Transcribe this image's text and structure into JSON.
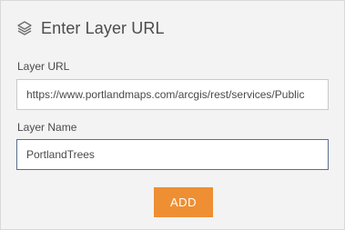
{
  "header": {
    "icon": "layers-icon",
    "title": "Enter Layer URL"
  },
  "form": {
    "url_label": "Layer URL",
    "url_value": "https://www.portlandmaps.com/arcgis/rest/services/Public",
    "name_label": "Layer Name",
    "name_value": "PortlandTrees"
  },
  "actions": {
    "add_label": "ADD",
    "add_color": "#ee8f33"
  }
}
